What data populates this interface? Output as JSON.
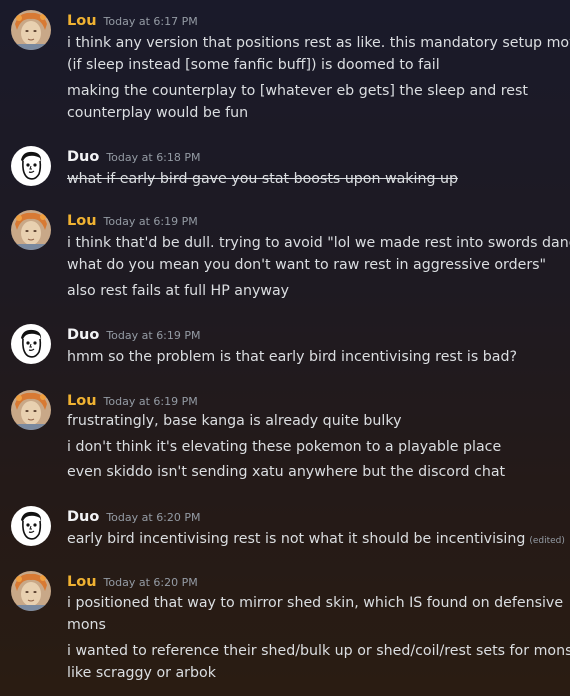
{
  "groups": [
    {
      "author": "Lou",
      "time": "Today at 6:17 PM",
      "lines": [
        "i think any version that positions rest as like. this mandatory setup move",
        "(if sleep instead [some fanfic buff]) is doomed to fail",
        "making the counterplay to [whatever eb gets] the sleep and rest",
        "counterplay would be fun"
      ]
    },
    {
      "author": "Duo",
      "time": "Today at 6:18 PM",
      "lines": [
        "what if early bird gave you stat boosts upon waking up"
      ]
    },
    {
      "author": "Lou",
      "time": "Today at 6:19 PM",
      "lines": [
        "i think that'd be dull. trying to avoid \"lol we made rest into swords dance.",
        "what do you mean you don't want to raw rest in aggressive orders\"",
        "also rest fails at full HP anyway"
      ]
    },
    {
      "author": "Duo",
      "time": "Today at 6:19 PM",
      "lines": [
        "hmm so the problem is that early bird incentivising rest is bad?"
      ]
    },
    {
      "author": "Lou",
      "time": "Today at 6:19 PM",
      "lines": [
        "frustratingly, base kanga is already quite bulky",
        "i don't think it's elevating these pokemon to a playable place",
        "even skiddo isn't sending xatu anywhere but the discord chat"
      ]
    },
    {
      "author": "Duo",
      "time": "Today at 6:20 PM",
      "lines": [
        "early bird incentivising rest is not what it should be incentivising"
      ],
      "edited_label": "(edited)"
    },
    {
      "author": "Lou",
      "time": "Today at 6:20 PM",
      "lines": [
        "i positioned that way to mirror shed skin, which IS found on defensive",
        "mons",
        "i wanted to reference their shed/bulk up or shed/coil/rest sets for mons",
        "like scraggy or arbok"
      ]
    }
  ],
  "colors": {
    "lou_name": "#f0b232",
    "duo_name": "#f2f3f5",
    "text": "#dbdee1",
    "muted": "#949ba4"
  }
}
